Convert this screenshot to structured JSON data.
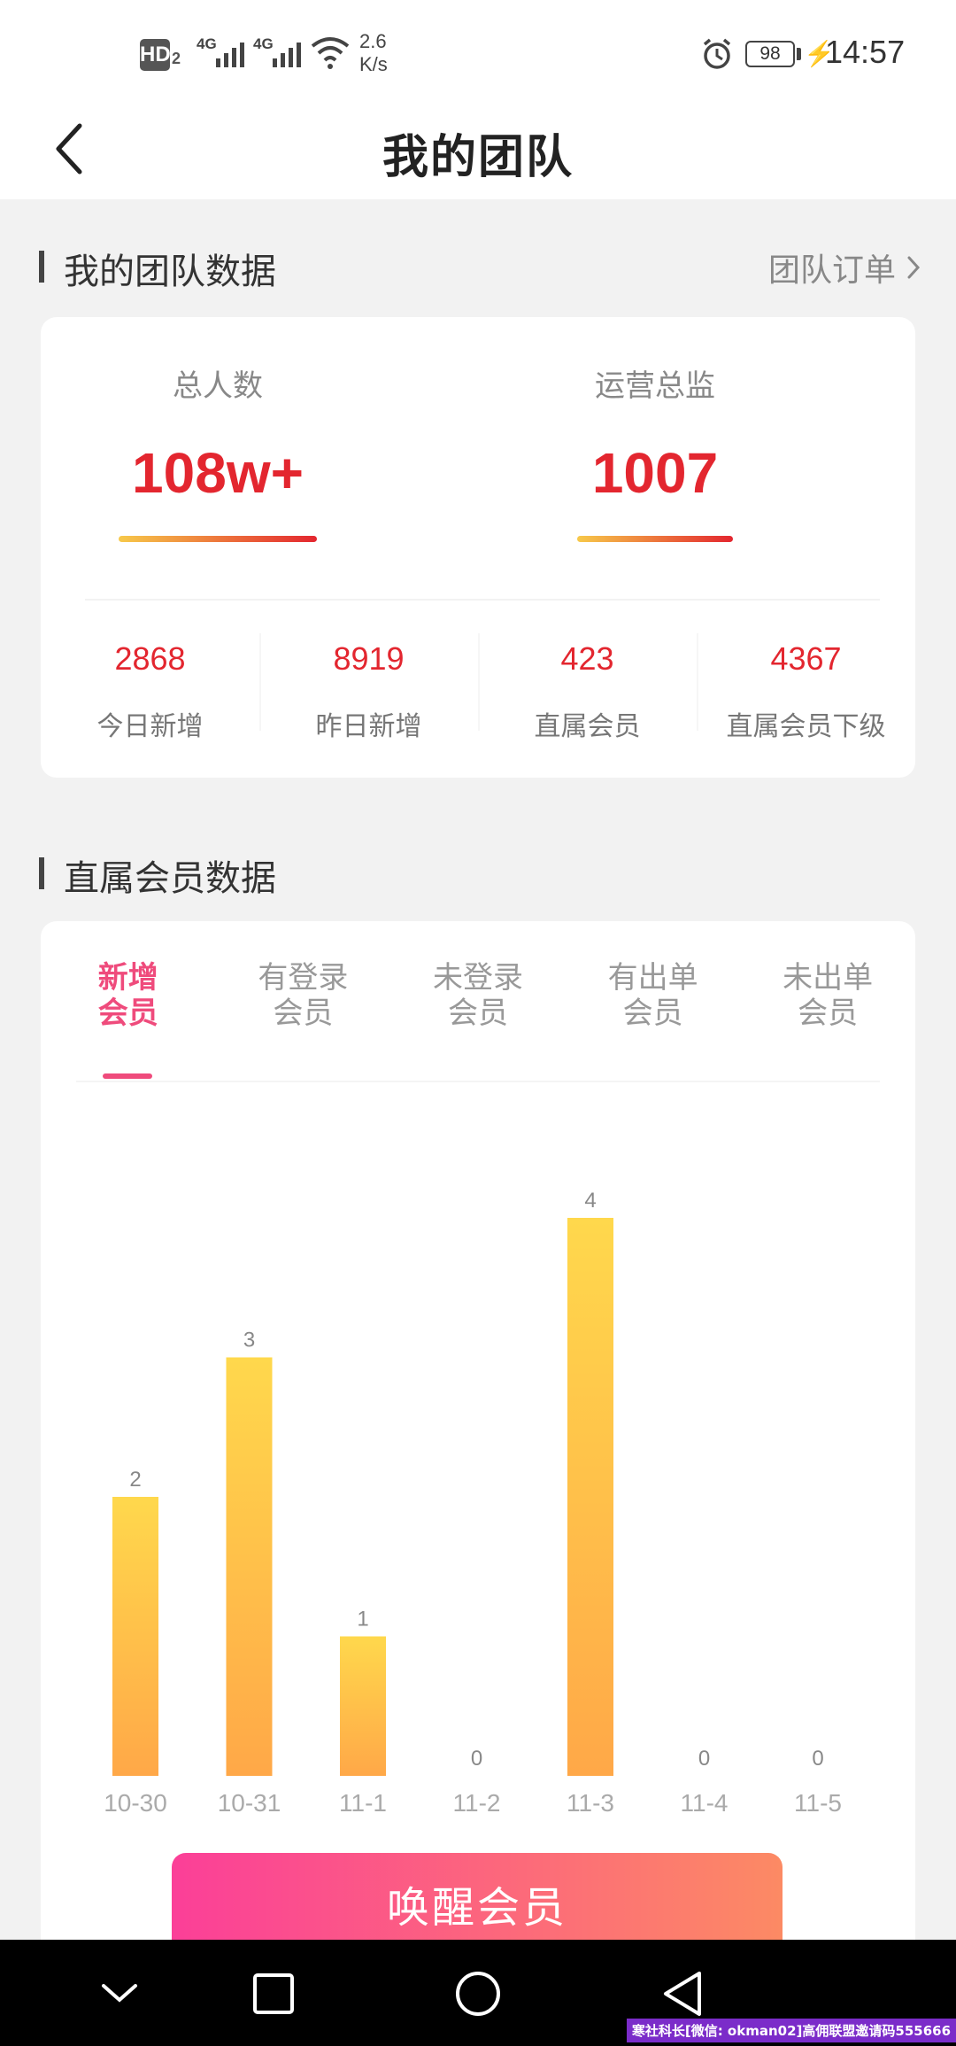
{
  "status_bar": {
    "hd_label": "HD",
    "hd_sub": "2",
    "signal1_label": "4G",
    "signal2_label": "4G",
    "speed_value": "2.6",
    "speed_unit": "K/s",
    "battery": "98",
    "time": "14:57"
  },
  "nav": {
    "title": "我的团队"
  },
  "team_section": {
    "title": "我的团队数据",
    "link_label": "团队订单",
    "total_label": "总人数",
    "total_value": "108w+",
    "director_label": "运营总监",
    "director_value": "1007",
    "stats": [
      {
        "value": "2868",
        "label": "今日新增"
      },
      {
        "value": "8919",
        "label": "昨日新增"
      },
      {
        "value": "423",
        "label": "直属会员"
      },
      {
        "value": "4367",
        "label": "直属会员下级"
      }
    ]
  },
  "members_section": {
    "title": "直属会员数据",
    "tabs": [
      {
        "line1": "新增",
        "line2": "会员",
        "active": true
      },
      {
        "line1": "有登录",
        "line2": "会员",
        "active": false
      },
      {
        "line1": "未登录",
        "line2": "会员",
        "active": false
      },
      {
        "line1": "有出单",
        "line2": "会员",
        "active": false
      },
      {
        "line1": "未出单",
        "line2": "会员",
        "active": false
      }
    ]
  },
  "chart_data": {
    "type": "bar",
    "categories": [
      "10-30",
      "10-31",
      "11-1",
      "11-2",
      "11-3",
      "11-4",
      "11-5"
    ],
    "values": [
      2,
      3,
      1,
      0,
      4,
      0,
      0
    ],
    "title": "",
    "xlabel": "",
    "ylabel": "",
    "ylim": [
      0,
      4
    ],
    "grid": false,
    "bar_gradient": [
      "#ffd84c",
      "#ffa848"
    ]
  },
  "cta": {
    "label": "唤醒会员"
  },
  "watermark": "寒社科长[微信: okman02]高佣联盟邀请码555666",
  "colors": {
    "accent_red": "#e3262f",
    "tab_active": "#ef4b7c",
    "cta_start": "#fb3f98",
    "cta_end": "#fc8a64"
  }
}
